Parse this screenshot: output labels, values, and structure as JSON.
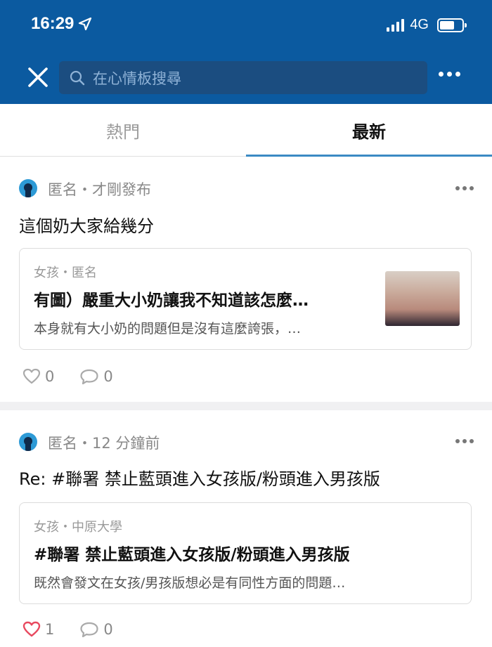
{
  "status_bar": {
    "time": "16:29",
    "network": "4G"
  },
  "nav": {
    "search_placeholder": "在心情板搜尋"
  },
  "tabs": [
    {
      "label": "熱門"
    },
    {
      "label": "最新"
    }
  ],
  "posts": [
    {
      "meta": "匿名・才剛發布",
      "title": "這個奶大家給幾分",
      "card": {
        "meta": "女孩・匿名",
        "title": "有圖）嚴重大小奶讓我不知道該怎麼…",
        "excerpt": "本身就有大小奶的問題但是沒有這麼誇張，…"
      },
      "likes": "0",
      "comments": "0"
    },
    {
      "meta": "匿名・12 分鐘前",
      "title": "Re: #聯署 禁止藍頭進入女孩版/粉頭進入男孩版",
      "card": {
        "meta": "女孩・中原大學",
        "title": "#聯署 禁止藍頭進入女孩版/粉頭進入男孩版",
        "excerpt": "既然會發文在女孩/男孩版想必是有同性方面的問題…"
      },
      "likes": "1",
      "comments": "0"
    }
  ],
  "colors": {
    "header": "#0b5aa0",
    "tab_underline": "#3b8ac4",
    "heart_active": "#e8485e"
  }
}
